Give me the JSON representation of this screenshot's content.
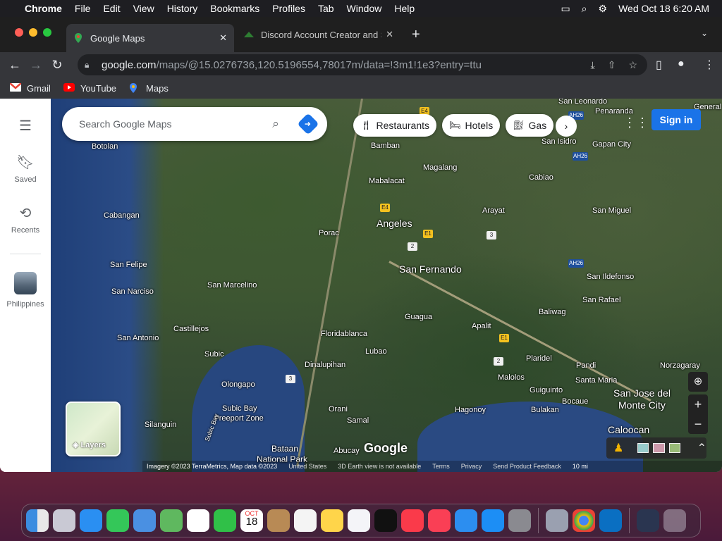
{
  "menubar": {
    "app": "Chrome",
    "items": [
      "File",
      "Edit",
      "View",
      "History",
      "Bookmarks",
      "Profiles",
      "Tab",
      "Window",
      "Help"
    ],
    "datetime": "Wed Oct 18  6:20 AM"
  },
  "tabs": [
    {
      "title": "Google Maps",
      "close": "✕"
    },
    {
      "title": "Discord Account Creator and S",
      "close": "✕"
    }
  ],
  "new_tab": "+",
  "address_bar": {
    "host": "google.com",
    "path": "/maps/@15.0276736,120.5196554,78017m/data=!3m1!1e3?entry=ttu"
  },
  "bookmarks": [
    {
      "label": "Gmail",
      "icon": "gmail-icon"
    },
    {
      "label": "YouTube",
      "icon": "youtube-icon"
    },
    {
      "label": "Maps",
      "icon": "maps-icon"
    }
  ],
  "sidebar": {
    "items": [
      {
        "label": "Saved",
        "icon": "bookmark-icon"
      },
      {
        "label": "Recents",
        "icon": "history-icon"
      },
      {
        "label": "Philippines",
        "icon": "photo-thumbnail"
      }
    ]
  },
  "search": {
    "placeholder": "Search Google Maps"
  },
  "chips": [
    "Restaurants",
    "Hotels",
    "Gas"
  ],
  "signin": "Sign in",
  "layers": "Layers",
  "map_labels": {
    "angeles": "Angeles",
    "san_fernando": "San Fernando",
    "caloocan": "Caloocan",
    "san_jose": "San Jose del",
    "monte_city": "Monte City",
    "bataan": "Bataan",
    "natpark": "National Park",
    "botolan": "Botolan",
    "cabangan": "Cabangan",
    "san_felipe": "San Felipe",
    "san_narciso": "San Narciso",
    "san_marcelino": "San Marcelino",
    "castillejos": "Castillejos",
    "san_antonio": "San Antonio",
    "subic": "Subic",
    "olongapo": "Olongapo",
    "subic_bay": "Subic Bay",
    "freeport": "Freeport Zone",
    "silanguin": "Silanguin",
    "porac": "Porac",
    "bamban": "Bamban",
    "mabalacat": "Mabalacat",
    "magalang": "Magalang",
    "arayat": "Arayat",
    "cabiao": "Cabiao",
    "san_isidro": "San Isidro",
    "gapan_city": "Gapan City",
    "san_miguel": "San Miguel",
    "san_leonardo": "San Leonardo",
    "penaranda": "Penaranda",
    "general": "General",
    "san_ildefonso": "San Ildefonso",
    "san_rafael": "San Rafael",
    "baliwag": "Baliwag",
    "apalit": "Apalit",
    "guagua": "Guagua",
    "floridablanca": "Floridablanca",
    "lubao": "Lubao",
    "dinalupihan": "Dinalupihan",
    "orani": "Orani",
    "samal": "Samal",
    "abucay": "Abucay",
    "hagonoy": "Hagonoy",
    "malolos": "Malolos",
    "plaridel": "Plaridel",
    "pandi": "Pandi",
    "santa_maria": "Santa Maria",
    "norzagaray": "Norzagaray",
    "guiguinto": "Guiguinto",
    "bocaue": "Bocaue",
    "bulakan": "Bulakan",
    "subic_bay_water": "Subic Bay"
  },
  "shields": {
    "e4a": "E4",
    "e4b": "E4",
    "e1a": "E1",
    "e1b": "E1",
    "r2a": "2",
    "r2b": "2",
    "r3a": "3",
    "r3b": "3",
    "ah26a": "AH26",
    "ah26b": "AH26",
    "ah26c": "AH26"
  },
  "google_logo": "Google",
  "footer": {
    "imagery": "Imagery ©2023 TerraMetrics, Map data ©2023",
    "country": "United States",
    "earth": "3D Earth view is not available",
    "terms": "Terms",
    "privacy": "Privacy",
    "feedback": "Send Product Feedback",
    "scale": "10 mi"
  },
  "dock": {
    "items": [
      "Finder",
      "Launchpad",
      "Safari",
      "Messages",
      "Mail",
      "Maps",
      "Photos",
      "FaceTime",
      "Calendar",
      "Contacts",
      "Reminders",
      "Notes",
      "Freeform",
      "TV",
      "Music",
      "News",
      "Keynote",
      "App Store",
      "System Settings",
      "Chrome",
      "VS Code",
      "Screen",
      "Trash"
    ],
    "calendar_month": "OCT",
    "calendar_day": "18"
  }
}
